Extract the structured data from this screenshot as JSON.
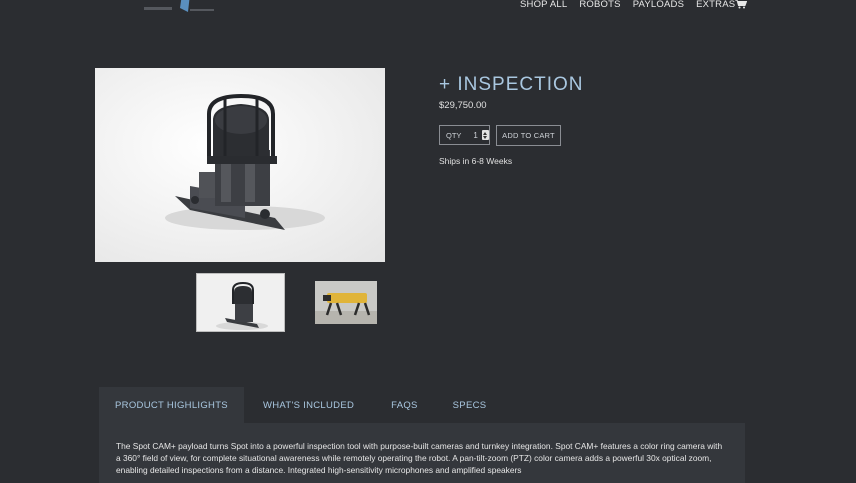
{
  "nav": {
    "items": [
      "SHOP ALL",
      "ROBOTS",
      "PAYLOADS",
      "EXTRAS"
    ],
    "cart_icon": "cart-icon",
    "logo_icon": "logo-icon"
  },
  "product": {
    "title": "+ INSPECTION",
    "price": "$29,750.00",
    "qty_label": "QTY",
    "qty_value": "1",
    "add_to_cart": "ADD TO CART",
    "shipping": "Ships in 6-8 Weeks"
  },
  "tabs": [
    {
      "label": "PRODUCT HIGHLIGHTS"
    },
    {
      "label": "WHAT'S INCLUDED"
    },
    {
      "label": "FAQS"
    },
    {
      "label": "SPECS"
    }
  ],
  "description": "The Spot CAM+ payload turns Spot into a powerful inspection tool with purpose-built cameras and turnkey integration. Spot CAM+ features a color ring camera with a 360° field of view, for complete situational awareness while remotely operating the robot. A pan-tilt-zoom (PTZ) color camera adds a powerful 30x optical zoom, enabling detailed inspections from a distance. Integrated high-sensitivity microphones and amplified speakers",
  "colors": {
    "background": "#2b2d31",
    "panel": "#34373c",
    "accent": "#a9c7e0"
  }
}
